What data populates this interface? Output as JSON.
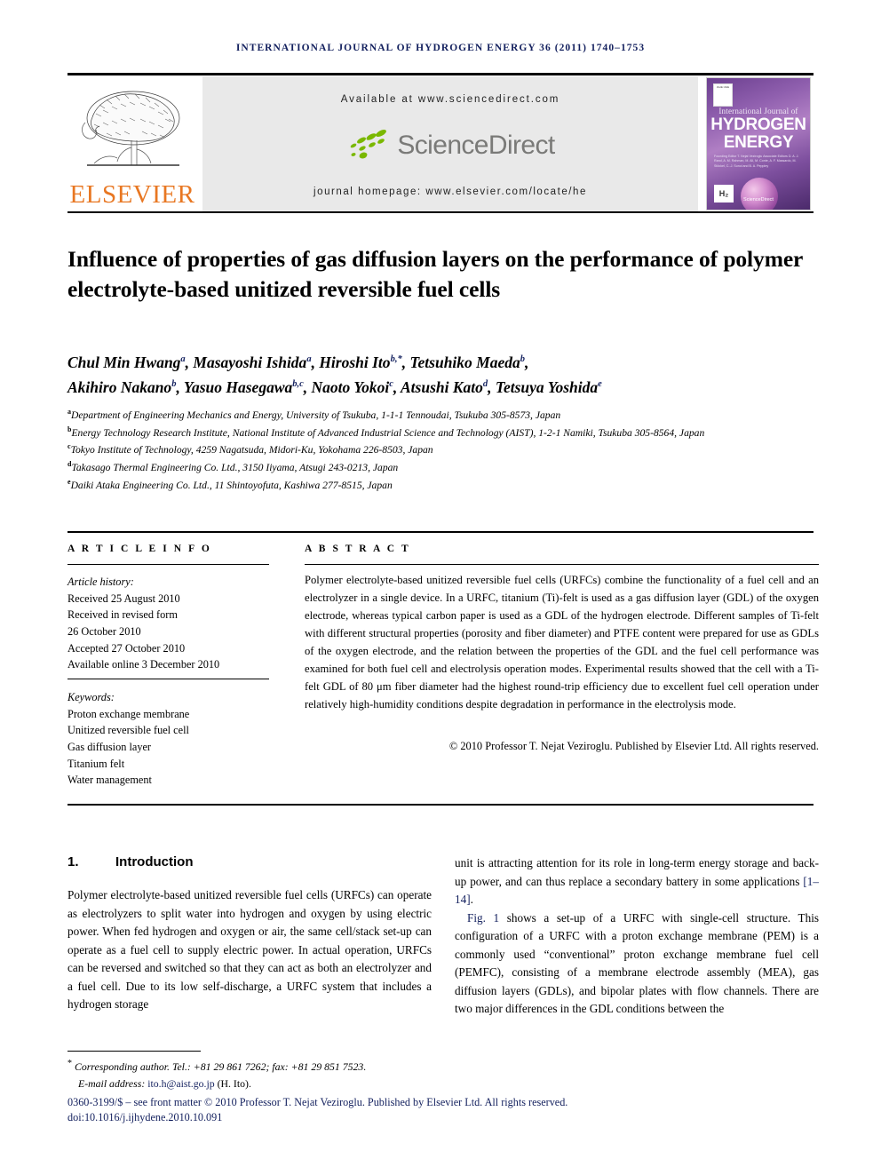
{
  "running_head": "International Journal of Hydrogen Energy 36 (2011) 1740–1753",
  "masthead": {
    "publisher_name": "ELSEVIER",
    "publisher_logo_alt": "elsevier-tree-logo",
    "available_at": "Available at www.sciencedirect.com",
    "sciencedirect_wordmark": "ScienceDirect",
    "journal_homepage": "journal homepage: www.elsevier.com/locate/he",
    "cover": {
      "line_small": "International Journal of",
      "line1": "HYDROGEN",
      "line2": "ENERGY",
      "editors": "Founding Editor    T. Nejat Veziroglu\nAssociate Editors   D. A. J. Rand, A. M. Rahman, M. Ali, M. Conte,\nA. F. Massardo, M. Stöckel,\nC.-J. Sunol and B. A. Peppley",
      "sciencedirect": "ScienceDirect",
      "badge_text": "IAHE\nIJHE",
      "hblock_text": "H₂"
    }
  },
  "title": "Influence of properties of gas diffusion layers on the performance of polymer electrolyte-based unitized reversible fuel cells",
  "authors": [
    {
      "name": "Chul Min Hwang",
      "sup": "a",
      "sep": ", "
    },
    {
      "name": "Masayoshi Ishida",
      "sup": "a",
      "sep": ", "
    },
    {
      "name": "Hiroshi Ito",
      "sup": "b,*",
      "sep": ", "
    },
    {
      "name": "Tetsuhiko Maeda",
      "sup": "b",
      "sep": ","
    },
    {
      "name": "Akihiro Nakano",
      "sup": "b",
      "sep": ", "
    },
    {
      "name": "Yasuo Hasegawa",
      "sup": "b,c",
      "sep": ", "
    },
    {
      "name": "Naoto Yokoi",
      "sup": "c",
      "sep": ", "
    },
    {
      "name": "Atsushi Kato",
      "sup": "d",
      "sep": ", "
    },
    {
      "name": "Tetsuya Yoshida",
      "sup": "e",
      "sep": ""
    }
  ],
  "affiliations": [
    {
      "sup": "a",
      "text": "Department of Engineering Mechanics and Energy, University of Tsukuba, 1-1-1 Tennoudai, Tsukuba 305-8573, Japan"
    },
    {
      "sup": "b",
      "text": "Energy Technology Research Institute, National Institute of Advanced Industrial Science and Technology (AIST), 1-2-1 Namiki, Tsukuba 305-8564, Japan"
    },
    {
      "sup": "c",
      "text": "Tokyo Institute of Technology, 4259 Nagatsuda, Midori-Ku, Yokohama 226-8503, Japan"
    },
    {
      "sup": "d",
      "text": "Takasago Thermal Engineering Co. Ltd., 3150 Iiyama, Atsugi 243-0213, Japan"
    },
    {
      "sup": "e",
      "text": "Daiki Ataka Engineering Co. Ltd., 11 Shintoyofuta, Kashiwa 277-8515, Japan"
    }
  ],
  "article_info": {
    "heading": "A R T I C L E   I N F O",
    "history_label": "Article history:",
    "history": [
      "Received 25 August 2010",
      "Received in revised form",
      "26 October 2010",
      "Accepted 27 October 2010",
      "Available online 3 December 2010"
    ],
    "keywords_label": "Keywords:",
    "keywords": [
      "Proton exchange membrane",
      "Unitized reversible fuel cell",
      "Gas diffusion layer",
      "Titanium felt",
      "Water management"
    ]
  },
  "abstract": {
    "heading": "A B S T R A C T",
    "text": "Polymer electrolyte-based unitized reversible fuel cells (URFCs) combine the functionality of a fuel cell and an electrolyzer in a single device. In a URFC, titanium (Ti)-felt is used as a gas diffusion layer (GDL) of the oxygen electrode, whereas typical carbon paper is used as a GDL of the hydrogen electrode. Different samples of Ti-felt with different structural properties (porosity and fiber diameter) and PTFE content were prepared for use as GDLs of the oxygen electrode, and the relation between the properties of the GDL and the fuel cell performance was examined for both fuel cell and electrolysis operation modes. Experimental results showed that the cell with a Ti-felt GDL of 80 μm fiber diameter had the highest round-trip efficiency due to excellent fuel cell operation under relatively high-humidity conditions despite degradation in performance in the electrolysis mode.",
    "copyright": "© 2010 Professor T. Nejat Veziroglu. Published by Elsevier Ltd. All rights reserved."
  },
  "body": {
    "section_number": "1.",
    "section_title": "Introduction",
    "left_column": "Polymer electrolyte-based unitized reversible fuel cells (URFCs) can operate as electrolyzers to split water into hydrogen and oxygen by using electric power. When fed hydrogen and oxygen or air, the same cell/stack set-up can operate as a fuel cell to supply electric power. In actual operation, URFCs can be reversed and switched so that they can act as both an electrolyzer and a fuel cell. Due to its low self-discharge, a URFC system that includes a hydrogen storage",
    "right_column_p1_before": "unit is attracting attention for its role in long-term energy storage and back-up power, and can thus replace a secondary battery in some applications ",
    "right_column_p1_ref": "[1–14]",
    "right_column_p1_after": ".",
    "right_column_p2_ref": "Fig. 1",
    "right_column_p2_after": " shows a set-up of a URFC with single-cell structure. This configuration of a URFC with a proton exchange membrane (PEM) is a commonly used “conventional” proton exchange membrane fuel cell (PEMFC), consisting of a membrane electrode assembly (MEA), gas diffusion layers (GDLs), and bipolar plates with flow channels. There are two major differences in the GDL conditions between the"
  },
  "footer": {
    "corresponding_marker": "*",
    "corresponding_text": "Corresponding author. Tel.: +81 29 861 7262; fax: +81 29 851 7523.",
    "email_label": "E-mail address: ",
    "email": "ito.h@aist.go.jp",
    "email_suffix": " (H. Ito).",
    "issn_line": "0360-3199/$ – see front matter © 2010 Professor T. Nejat Veziroglu. Published by Elsevier Ltd. All rights reserved.",
    "doi_line": "doi:10.1016/j.ijhydene.2010.10.091"
  },
  "colors": {
    "link_blue": "#13205e",
    "elsevier_orange": "#e87722",
    "sciencedirect_grey": "#7a7a78",
    "band_grey": "#e9e9e9"
  }
}
